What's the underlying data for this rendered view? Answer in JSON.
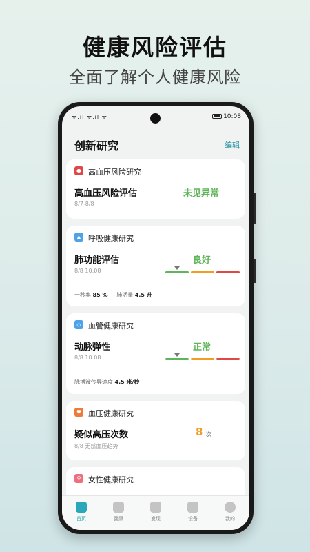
{
  "headline": "健康风险评估",
  "subline": "全面了解个人健康风险",
  "status_bar": {
    "signal": "ᯤ.ıl ᯤ.ıl ᯤ",
    "time": "10:08"
  },
  "header": {
    "title": "创新研究",
    "edit": "编辑"
  },
  "cards": [
    {
      "category": "高血压风险研究",
      "metric": "高血压风险评估",
      "date": "8/7-8/8",
      "status": "未见异常"
    },
    {
      "category": "呼吸健康研究",
      "metric": "肺功能评估",
      "date": "8/8 10:08",
      "status": "良好",
      "stats": [
        {
          "label": "一秒率",
          "value": "85 %"
        },
        {
          "label": "肺活量",
          "value": "4.5 升"
        }
      ]
    },
    {
      "category": "血管健康研究",
      "metric": "动脉弹性",
      "date": "8/8 10:08",
      "status": "正常",
      "stats": [
        {
          "label": "脉搏波传导速度",
          "value": "4.5 米/秒"
        }
      ]
    },
    {
      "category": "血压健康研究",
      "metric": "疑似高压次数",
      "date": "8/8 无感血压趋势",
      "count": "8",
      "count_unit": "次"
    },
    {
      "category": "女性健康研究"
    }
  ],
  "scale_colors": {
    "good": "#5fb55a",
    "mid": "#f39c23",
    "bad": "#e04848"
  },
  "accent_color": "#2aa7b8",
  "tabs": [
    {
      "label": "首页",
      "icon": "home-icon",
      "active": true
    },
    {
      "label": "健康",
      "icon": "heartbeat-icon"
    },
    {
      "label": "发现",
      "icon": "discover-icon"
    },
    {
      "label": "设备",
      "icon": "watch-icon"
    },
    {
      "label": "我的",
      "icon": "profile-icon"
    }
  ]
}
